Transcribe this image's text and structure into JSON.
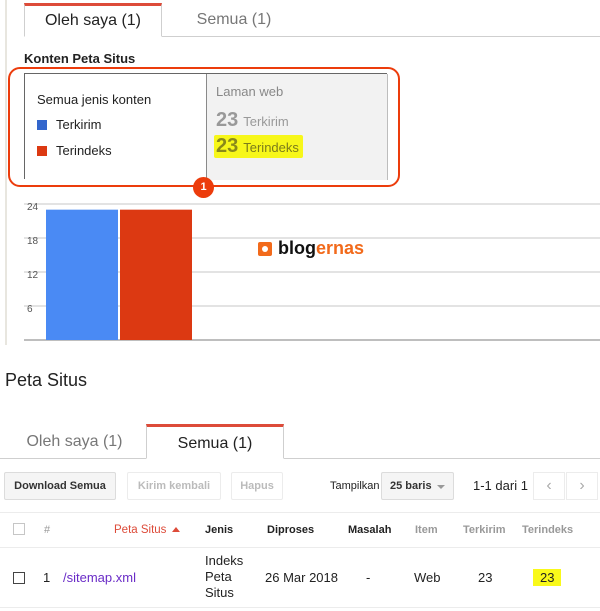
{
  "top_panel": {
    "tabs": [
      {
        "label": "Oleh saya (1)",
        "active": true
      },
      {
        "label": "Semua (1)",
        "active": false
      }
    ],
    "section_label": "Konten Peta Situs",
    "legend": {
      "title": "Semua jenis konten",
      "items": [
        {
          "label": "Terkirim",
          "color": "#3366cc"
        },
        {
          "label": "Terindeks",
          "color": "#dc3912"
        }
      ]
    },
    "stats": {
      "title": "Laman web",
      "rows": [
        {
          "value": "23",
          "label": "Terkirim",
          "highlighted": false
        },
        {
          "value": "23",
          "label": "Terindeks",
          "highlighted": true
        }
      ]
    },
    "annotation_badge": "1",
    "watermark": {
      "part1": "blog",
      "part2": "ernas"
    }
  },
  "chart_data": {
    "type": "bar",
    "title": "",
    "xlabel": "",
    "ylabel": "",
    "categories": [
      "Laman web"
    ],
    "series": [
      {
        "name": "Terkirim",
        "values": [
          23
        ],
        "color": "#4a8af4"
      },
      {
        "name": "Terindeks",
        "values": [
          23
        ],
        "color": "#dc3912"
      }
    ],
    "yticks": [
      "24",
      "18",
      "12",
      "6"
    ],
    "ylim": [
      0,
      24
    ],
    "grid": true,
    "legend": "none"
  },
  "bottom_panel": {
    "page_title": "Peta Situs",
    "tabs": [
      {
        "label": "Oleh saya (1)",
        "active": false
      },
      {
        "label": "Semua (1)",
        "active": true
      }
    ],
    "toolbar": {
      "download_label": "Download Semua",
      "resubmit_label": "Kirim kembali",
      "delete_label": "Hapus",
      "show_label": "Tampilkan",
      "rows_select": "25 baris",
      "pager_text": "1-1 dari 1",
      "prev_icon": "‹",
      "next_icon": "›"
    },
    "table": {
      "headers": {
        "index": "#",
        "sitemap": "Peta Situs",
        "type": "Jenis",
        "processed": "Diproses",
        "issues": "Masalah",
        "items": "Item",
        "submitted": "Terkirim",
        "indexed": "Terindeks"
      },
      "rows": [
        {
          "index": "1",
          "sitemap": "/sitemap.xml",
          "type_lines": [
            "Indeks",
            "Peta",
            "Situs"
          ],
          "processed": "26 Mar 2018",
          "issues": "-",
          "items": "Web",
          "submitted": "23",
          "indexed": "23"
        }
      ]
    }
  }
}
